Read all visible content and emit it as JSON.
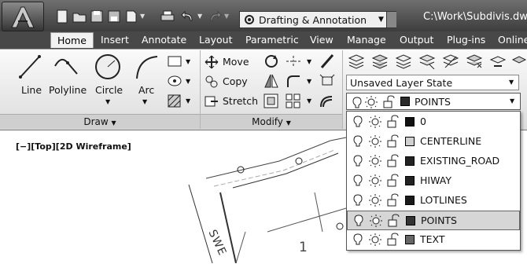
{
  "window": {
    "document_path": "C:\\Work\\Subdivis.dwg"
  },
  "workspace": {
    "value": "Drafting & Annotation"
  },
  "tabs": [
    "Home",
    "Insert",
    "Annotate",
    "Layout",
    "Parametric",
    "View",
    "Manage",
    "Output",
    "Plug-ins",
    "Online"
  ],
  "active_tab": "Home",
  "draw_panel": {
    "title": "Draw",
    "tools": [
      {
        "label": "Line",
        "icon": "line-icon"
      },
      {
        "label": "Polyline",
        "icon": "polyline-icon"
      },
      {
        "label": "Circle",
        "icon": "circle-icon"
      },
      {
        "label": "Arc",
        "icon": "arc-icon"
      }
    ]
  },
  "modify_panel": {
    "title": "Modify",
    "tools": [
      {
        "label": "Move",
        "icon": "move-icon"
      },
      {
        "label": "Copy",
        "icon": "copy-icon"
      },
      {
        "label": "Stretch",
        "icon": "stretch-icon"
      }
    ]
  },
  "layers_panel": {
    "layer_state": "Unsaved Layer State",
    "current_layer": "POINTS",
    "current_color": "#2b2b2b",
    "layers": [
      {
        "name": "0",
        "color": "#111111",
        "selected": false
      },
      {
        "name": "CENTERLINE",
        "color": "#d0d0d0",
        "selected": false
      },
      {
        "name": "EXISTING_ROAD",
        "color": "#222222",
        "selected": false
      },
      {
        "name": "HIWAY",
        "color": "#222222",
        "selected": false
      },
      {
        "name": "LOTLINES",
        "color": "#1a1a1a",
        "selected": false
      },
      {
        "name": "POINTS",
        "color": "#333333",
        "selected": true
      },
      {
        "name": "TEXT",
        "color": "#666666",
        "selected": false
      }
    ]
  },
  "viewport": {
    "label": "[−][Top][2D Wireframe]"
  },
  "drawing_text": {
    "street": "SWE",
    "lot_number": "1"
  }
}
